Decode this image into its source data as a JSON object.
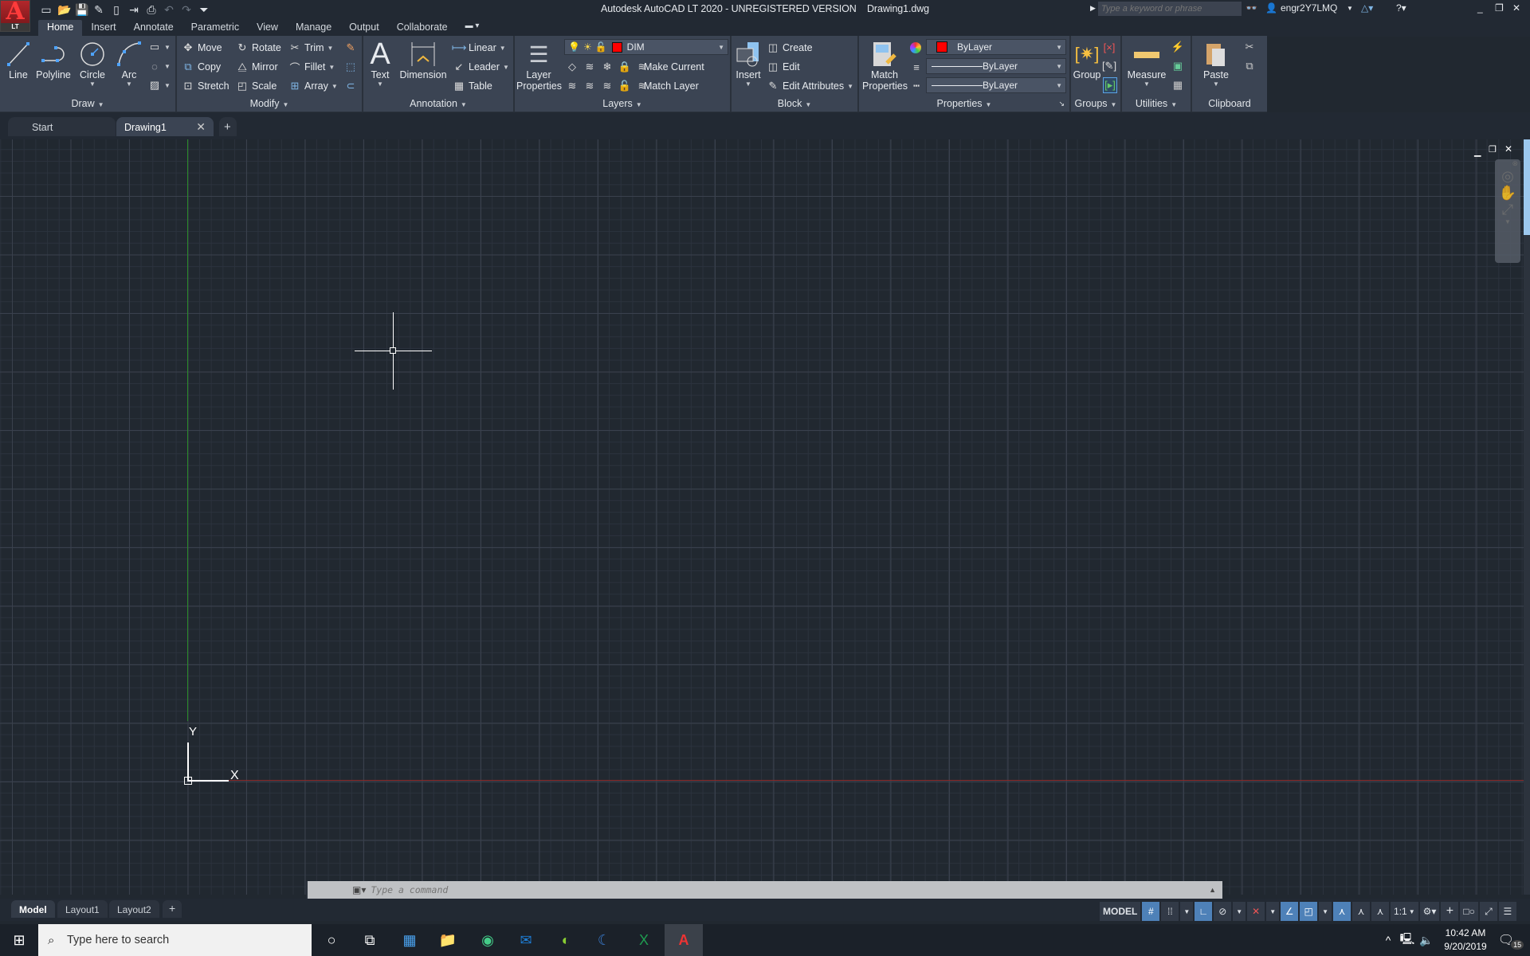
{
  "app": {
    "logo_letter": "A",
    "logo_badge": "LT",
    "window_title": "Autodesk AutoCAD LT 2020 - UNREGISTERED VERSION",
    "file_name": "Drawing1.dwg",
    "search_placeholder": "Type a keyword or phrase",
    "user": "engr2Y7LMQ"
  },
  "quick_access": [
    "new-icon",
    "open-icon",
    "save-icon",
    "save-as-icon",
    "open-sheet-icon",
    "publish-icon",
    "plot-icon",
    "undo-icon",
    "redo-icon",
    "customize-icon"
  ],
  "ribbon_tabs": [
    {
      "label": "Home",
      "active": true
    },
    {
      "label": "Insert"
    },
    {
      "label": "Annotate"
    },
    {
      "label": "Parametric"
    },
    {
      "label": "View"
    },
    {
      "label": "Manage"
    },
    {
      "label": "Output"
    },
    {
      "label": "Collaborate"
    }
  ],
  "panels": {
    "draw": {
      "title": "Draw",
      "line": "Line",
      "polyline": "Polyline",
      "circle": "Circle",
      "arc": "Arc"
    },
    "modify": {
      "title": "Modify",
      "move": "Move",
      "rotate": "Rotate",
      "trim": "Trim",
      "copy": "Copy",
      "mirror": "Mirror",
      "fillet": "Fillet",
      "stretch": "Stretch",
      "scale": "Scale",
      "array": "Array"
    },
    "annotation": {
      "title": "Annotation",
      "text": "Text",
      "dimension": "Dimension",
      "linear": "Linear",
      "leader": "Leader",
      "table": "Table"
    },
    "layers": {
      "title": "Layers",
      "layer_properties_1": "Layer",
      "layer_properties_2": "Properties",
      "current_layer": "DIM",
      "make_current": "Make Current",
      "match_layer": "Match Layer"
    },
    "block": {
      "title": "Block",
      "insert": "Insert",
      "create": "Create",
      "edit": "Edit",
      "edit_attributes": "Edit Attributes"
    },
    "properties": {
      "title": "Properties",
      "match_1": "Match",
      "match_2": "Properties",
      "color": "ByLayer",
      "lineweight": "ByLayer",
      "linetype": "ByLayer"
    },
    "groups": {
      "title": "Groups",
      "group": "Group"
    },
    "utilities": {
      "title": "Utilities",
      "measure": "Measure"
    },
    "clipboard": {
      "title": "Clipboard",
      "paste": "Paste"
    }
  },
  "doc_tabs": [
    {
      "label": "Start"
    },
    {
      "label": "Drawing1",
      "active": true
    }
  ],
  "ucs": {
    "x_label": "X",
    "y_label": "Y"
  },
  "command_line": {
    "placeholder": "Type a command"
  },
  "layout_tabs": [
    {
      "label": "Model",
      "active": true
    },
    {
      "label": "Layout1"
    },
    {
      "label": "Layout2"
    }
  ],
  "status_bar": {
    "model": "MODEL",
    "scale": "1:1"
  },
  "taskbar": {
    "search_placeholder": "Type here to search",
    "time": "10:42 AM",
    "date": "9/20/2019",
    "notifications": "15"
  },
  "colors": {
    "accent": "#4e81b8",
    "layer_color": "#ff0000",
    "x_axis": "#8a2a2a",
    "y_axis": "#2a8a2a"
  }
}
